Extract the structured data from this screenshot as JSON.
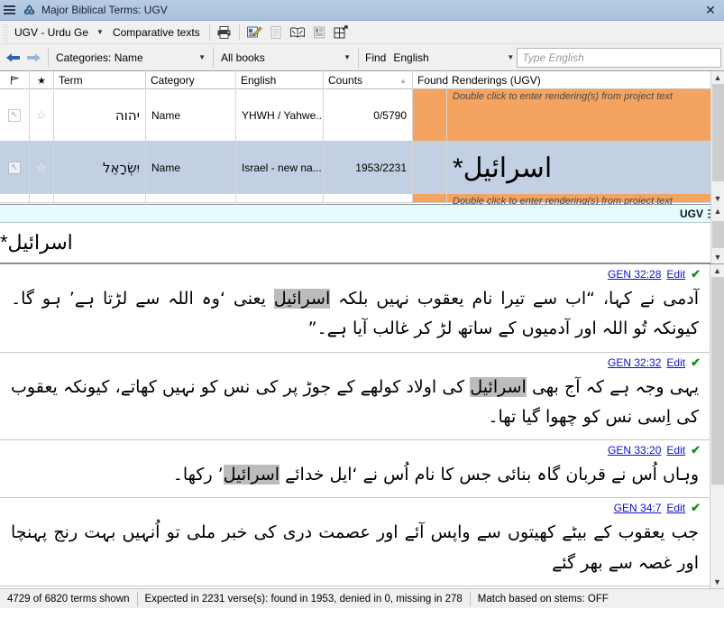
{
  "window": {
    "title": "Major Biblical Terms: UGV",
    "app_icon": "trinity-knot-icon",
    "menu_icon": "hamburger-menu-icon",
    "close_label": "✕"
  },
  "toolbar": {
    "project_combo": "UGV - Urdu Ge",
    "comparative_texts": "Comparative texts",
    "icons": [
      {
        "name": "print-icon",
        "glyph": "print"
      },
      {
        "name": "edit-note-icon",
        "glyph": "note-edit"
      },
      {
        "name": "document-icon",
        "glyph": "document"
      },
      {
        "name": "open-book-icon",
        "glyph": "book"
      },
      {
        "name": "text-list-icon",
        "glyph": "list"
      },
      {
        "name": "detach-window-icon",
        "glyph": "detach"
      }
    ]
  },
  "filterbar": {
    "back_icon": "back-arrow-icon",
    "forward_icon": "forward-arrow-icon",
    "categories": "Categories: Name",
    "books": "All books",
    "find_label": "Find",
    "find_language": "English",
    "find_placeholder": "Type English"
  },
  "grid": {
    "columns": [
      {
        "key": "flag",
        "label": "",
        "icon": "flag-icon"
      },
      {
        "key": "star",
        "label": "",
        "icon": "star-icon"
      },
      {
        "key": "term",
        "label": "Term"
      },
      {
        "key": "category",
        "label": "Category"
      },
      {
        "key": "english",
        "label": "English"
      },
      {
        "key": "counts",
        "label": "Counts",
        "sorted": "asc"
      },
      {
        "key": "found",
        "label": "Found"
      },
      {
        "key": "renderings",
        "label": "Renderings (UGV)"
      }
    ],
    "rows": [
      {
        "selected": false,
        "term": "יהוה",
        "category": "Name",
        "english": "YHWH / Yahwe...",
        "counts": "0/5790",
        "found": "",
        "renderings": "Double click to enter rendering(s) from project text",
        "renderings_is_placeholder": true
      },
      {
        "selected": true,
        "term": "יִשְׂרָאֵל",
        "category": "Name",
        "english": "Israel - new na...",
        "counts": "1953/2231",
        "found": "",
        "renderings": "اسرائیل*",
        "renderings_is_placeholder": false
      },
      {
        "selected": false,
        "term": "",
        "category": "",
        "english": "",
        "counts": "",
        "found": "",
        "renderings": "Double click to enter rendering(s) from project text",
        "renderings_is_placeholder": true
      }
    ]
  },
  "renderings_editor": {
    "header_label": "UGV",
    "header_icon": "rendering-edit-icon",
    "value": "اسرائیل*"
  },
  "verses": [
    {
      "reference": "GEN 32:28",
      "edit_label": "Edit",
      "approved": true,
      "segments": [
        {
          "text": "آدمی نے کہا، “اب سے تیرا نام یعقوب نہیں بلکہ ",
          "highlight": false
        },
        {
          "text": "اسرائیل",
          "highlight": true
        },
        {
          "text": " یعنی ‘وہ اللہ سے لڑتا ہے’ ہو گا۔ کیونکہ تُو اللہ اور آدمیوں کے ساتھ لڑ کر غالب آیا ہے۔”",
          "highlight": false
        }
      ]
    },
    {
      "reference": "GEN 32:32",
      "edit_label": "Edit",
      "approved": true,
      "segments": [
        {
          "text": "یہی وجہ ہے کہ آج بھی ",
          "highlight": false
        },
        {
          "text": "اسرائیل",
          "highlight": true
        },
        {
          "text": " کی اولاد کولھے کے جوڑ پر کی نس کو نہیں کھاتے، کیونکہ یعقوب کی اِسی نس کو چھوا گیا تھا۔",
          "highlight": false
        }
      ]
    },
    {
      "reference": "GEN 33:20",
      "edit_label": "Edit",
      "approved": true,
      "segments": [
        {
          "text": "وہاں اُس نے قربان گاہ بنائی جس کا نام اُس نے ‘ایل خدائے ",
          "highlight": false
        },
        {
          "text": "اسرائیل",
          "highlight": true
        },
        {
          "text": "’ رکھا۔",
          "highlight": false
        }
      ]
    },
    {
      "reference": "GEN 34:7",
      "edit_label": "Edit",
      "approved": true,
      "segments": [
        {
          "text": "جب یعقوب کے بیٹے کھیتوں سے واپس آئے اور عصمت دری کی خبر ملی تو اُنہیں بہت رنج پہنچا اور غصہ سے بھر گئے",
          "highlight": false
        }
      ]
    }
  ],
  "statusbar": {
    "terms_shown": "4729 of 6820 terms shown",
    "expected": "Expected in 2231 verse(s): found in 1953, denied in 0, missing in 278",
    "stems": "Match based on stems: OFF"
  },
  "colors": {
    "title_bg": "#b8cce4",
    "rendering_highlight": "#f4a460",
    "selected_row": "#c3cfe2",
    "ugv_header": "#e4fbfd",
    "link": "#1010d0",
    "check": "#149014"
  }
}
